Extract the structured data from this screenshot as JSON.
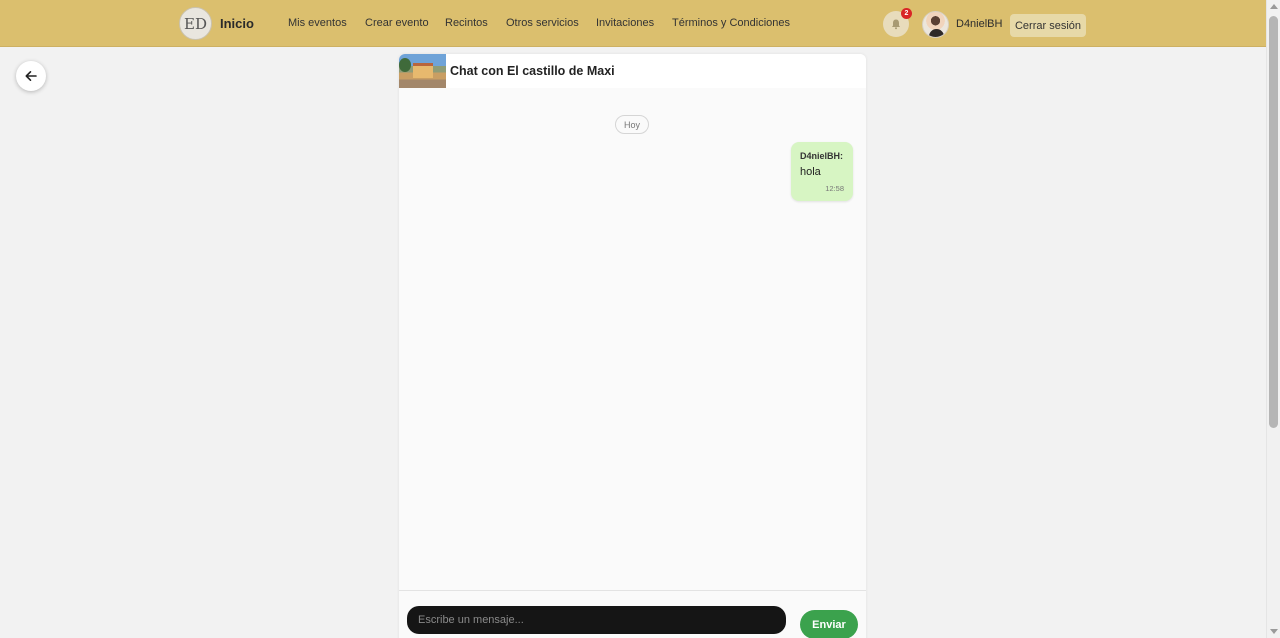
{
  "navbar": {
    "logo_text": "ED",
    "brand": "Inicio",
    "links": [
      {
        "label": "Mis eventos",
        "name": "nav-link-mis-eventos"
      },
      {
        "label": "Crear evento",
        "name": "nav-link-crear-evento"
      },
      {
        "label": "Recintos",
        "name": "nav-link-recintos"
      },
      {
        "label": "Otros servicios",
        "name": "nav-link-otros-servicios"
      },
      {
        "label": "Invitaciones",
        "name": "nav-link-invitaciones"
      },
      {
        "label": "Términos y Condiciones",
        "name": "nav-link-terminos"
      }
    ],
    "notifications_icon": "bell-icon",
    "notifications_count": "2",
    "username": "D4nielBH",
    "logout_label": "Cerrar sesión",
    "accent_color": "#dbbf6e"
  },
  "back_icon": "arrow-left-icon",
  "chat": {
    "title": "Chat con El castillo de Maxi",
    "day_separator": "Hoy",
    "messages": [
      {
        "sender": "D4nielBH:",
        "text": "hola",
        "time": "12:58"
      }
    ],
    "input_placeholder": "Escribe un mensaje...",
    "send_label": "Enviar",
    "send_color": "#3ba24d",
    "own_message_color": "#d7f5c3"
  }
}
